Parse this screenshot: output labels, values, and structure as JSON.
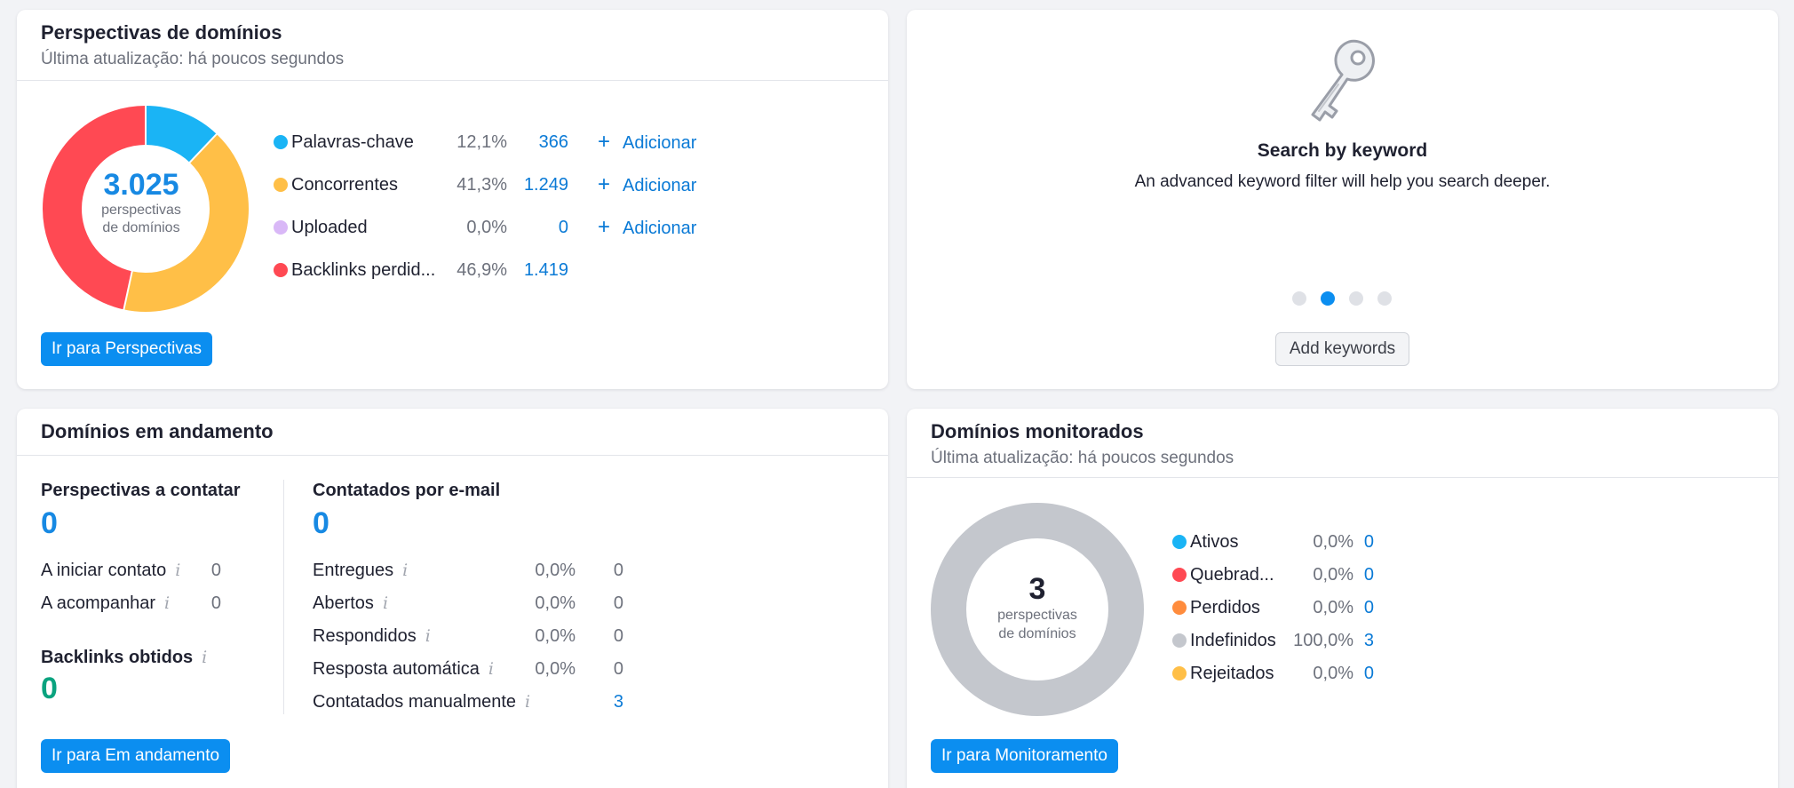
{
  "prospects": {
    "title": "Perspectivas de domínios",
    "subtitle": "Última atualização: há poucos segundos",
    "total": "3.025",
    "total_label_1": "perspectivas",
    "total_label_2": "de domínios",
    "rows": [
      {
        "label": "Palavras-chave",
        "pct": "12,1%",
        "count": "366",
        "add": "Adicionar",
        "color": "#1ab4f5"
      },
      {
        "label": "Concorrentes",
        "pct": "41,3%",
        "count": "1.249",
        "add": "Adicionar",
        "color": "#ffbf47"
      },
      {
        "label": "Uploaded",
        "pct": "0,0%",
        "count": "0",
        "add": "Adicionar",
        "color": "#d9b8f7"
      },
      {
        "label": "Backlinks perdid...",
        "pct": "46,9%",
        "count": "1.419",
        "color": "#ff4953"
      }
    ],
    "add_symbol": "+",
    "button": "Ir para Perspectivas"
  },
  "keyword_promo": {
    "title": "Search by keyword",
    "text": "An advanced keyword filter will help you search deeper.",
    "icon": "key-icon",
    "slides": 4,
    "active_slide": 2,
    "button": "Add keywords"
  },
  "in_progress": {
    "title": "Domínios em andamento",
    "to_contact_label": "Perspectivas a contatar",
    "to_contact_value": "0",
    "left_rows": [
      {
        "label": "A iniciar contato",
        "value": "0"
      },
      {
        "label": "A acompanhar",
        "value": "0"
      }
    ],
    "backlinks_label": "Backlinks obtidos",
    "backlinks_value": "0",
    "emailed_label": "Contatados por e-mail",
    "emailed_value": "0",
    "right_rows": [
      {
        "label": "Entregues",
        "pct": "0,0%",
        "value": "0"
      },
      {
        "label": "Abertos",
        "pct": "0,0%",
        "value": "0"
      },
      {
        "label": "Respondidos",
        "pct": "0,0%",
        "value": "0"
      },
      {
        "label": "Resposta automática",
        "pct": "0,0%",
        "value": "0"
      },
      {
        "label": "Contatados manualmente",
        "pct": "",
        "value": "3"
      }
    ],
    "info_symbol": "i",
    "button": "Ir para Em andamento"
  },
  "monitored": {
    "title": "Domínios monitorados",
    "subtitle": "Última atualização: há poucos segundos",
    "total": "3",
    "total_label_1": "perspectivas",
    "total_label_2": "de domínios",
    "rows": [
      {
        "label": "Ativos",
        "pct": "0,0%",
        "count": "0",
        "color": "#1ab4f5"
      },
      {
        "label": "Quebrad...",
        "pct": "0,0%",
        "count": "0",
        "color": "#ff4953"
      },
      {
        "label": "Perdidos",
        "pct": "0,0%",
        "count": "0",
        "color": "#ff8c3d"
      },
      {
        "label": "Indefinidos",
        "pct": "100,0%",
        "count": "3",
        "color": "#c4c7cd"
      },
      {
        "label": "Rejeitados",
        "pct": "0,0%",
        "count": "0",
        "color": "#ffbf47"
      }
    ],
    "button": "Ir para Monitoramento"
  }
}
